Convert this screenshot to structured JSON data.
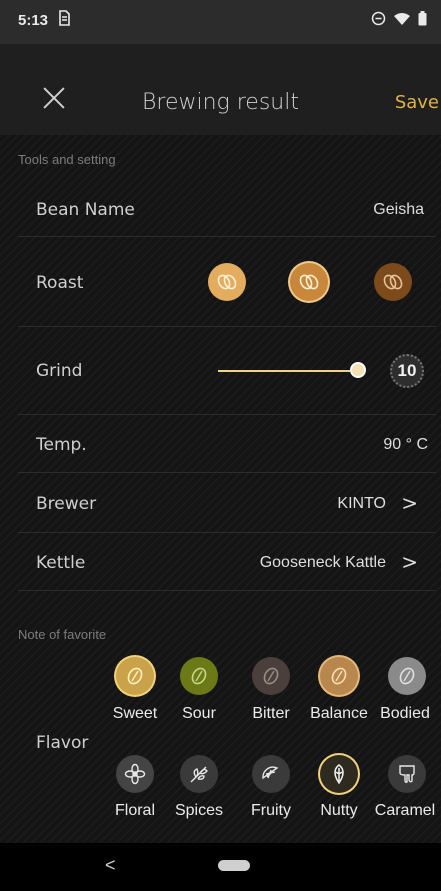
{
  "status": {
    "time": "5:13",
    "sim_icon": "sim-icon",
    "dnd_icon": "do-not-disturb-icon",
    "wifi_icon": "wifi-icon",
    "battery_icon": "battery-icon"
  },
  "appbar": {
    "title": "Brewing result",
    "save_label": "Save",
    "close_icon": "close-icon"
  },
  "tools": {
    "section_label": "Tools and setting",
    "bean_name": {
      "label": "Bean Name",
      "value": "Geisha"
    },
    "roast": {
      "label": "Roast",
      "levels": [
        "light",
        "medium",
        "dark"
      ],
      "colors": [
        "#d9a45a",
        "#c4843c",
        "#7a4a1c"
      ]
    },
    "grind": {
      "label": "Grind",
      "value": "10",
      "level": 1.0
    },
    "temp": {
      "label": "Temp.",
      "value": "90 ° C"
    },
    "brewer": {
      "label": "Brewer",
      "value": "KINTO",
      "chevron": ">"
    },
    "kettle": {
      "label": "Kettle",
      "value": "Gooseneck Kattle",
      "chevron": ">"
    }
  },
  "favorite": {
    "section_label": "Note of favorite",
    "flavor_label": "Flavor",
    "row1": [
      {
        "name": "Sweet",
        "icon": "coffee-bean-icon",
        "color": "#c9a24a"
      },
      {
        "name": "Sour",
        "icon": "coffee-bean-icon",
        "color": "#6b7a16"
      },
      {
        "name": "Bitter",
        "icon": "coffee-bean-icon",
        "color": "#4a3f3a"
      },
      {
        "name": "Balance",
        "icon": "coffee-bean-icon",
        "color": "#b8874e"
      },
      {
        "name": "Bodied",
        "icon": "coffee-bean-icon",
        "color": "#8a8a8a"
      }
    ],
    "row2": [
      {
        "name": "Floral",
        "icon": "flower-icon",
        "color": "#444444"
      },
      {
        "name": "Spices",
        "icon": "leaf-icon",
        "color": "#3a3a3a"
      },
      {
        "name": "Fruity",
        "icon": "lemon-icon",
        "color": "#3a3a3a"
      },
      {
        "name": "Nutty",
        "icon": "nut-icon",
        "color": "#3a3a3a"
      },
      {
        "name": "Caramel",
        "icon": "caramel-icon",
        "color": "#3a3a3a"
      }
    ]
  },
  "nav": {
    "back": "<"
  }
}
